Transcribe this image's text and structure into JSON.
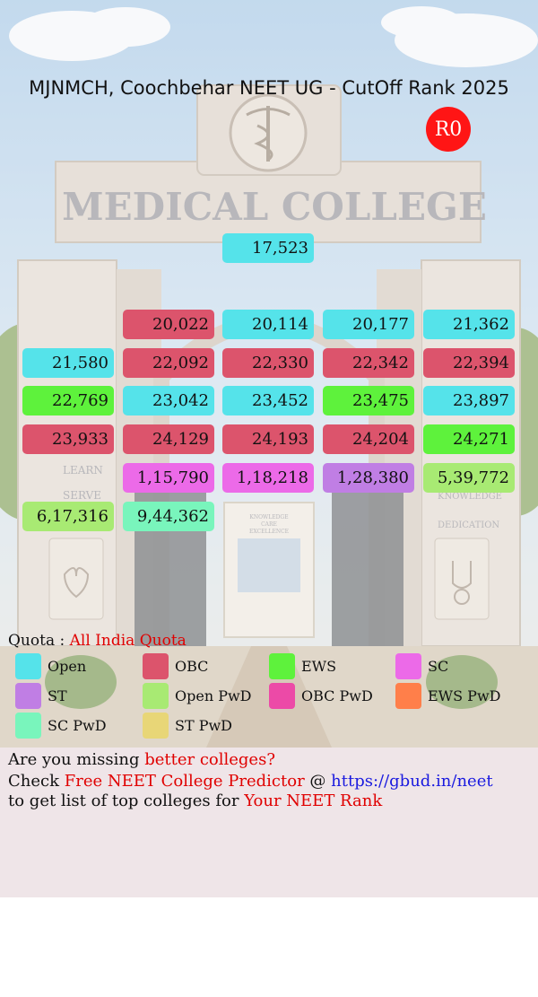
{
  "header": {
    "title": "MJNMCH, Coochbehar NEET UG - CutOff Rank 2025",
    "round_badge": "R0"
  },
  "background": {
    "gate_text": "MEDICAL COLLEGE",
    "left_pillar_words": [
      "LEARN",
      "SERVE"
    ],
    "right_pillar_words": [
      "KNOWLEDGE",
      "DEDICATION"
    ],
    "far_building_words": [
      "KNOWLEDGE",
      "CARE",
      "EXCELLENCE"
    ]
  },
  "colors": {
    "Open": "#55e3ea",
    "OBC": "#dc546c",
    "EWS": "#5ef23c",
    "SC": "#ec6ae8",
    "ST": "#c07ee4",
    "Open PwD": "#a8ea73",
    "OBC PwD": "#ec4aa7",
    "EWS PwD": "#ff7f4a",
    "SC PwD": "#79f5bc",
    "ST PwD": "#e8d677"
  },
  "ranks": [
    {
      "value": "17,523",
      "category": "Open"
    },
    {
      "value": "20,022",
      "category": "OBC"
    },
    {
      "value": "20,114",
      "category": "Open"
    },
    {
      "value": "20,177",
      "category": "Open"
    },
    {
      "value": "21,362",
      "category": "Open"
    },
    {
      "value": "21,580",
      "category": "Open"
    },
    {
      "value": "22,092",
      "category": "OBC"
    },
    {
      "value": "22,330",
      "category": "OBC"
    },
    {
      "value": "22,342",
      "category": "OBC"
    },
    {
      "value": "22,394",
      "category": "OBC"
    },
    {
      "value": "22,769",
      "category": "EWS"
    },
    {
      "value": "23,042",
      "category": "Open"
    },
    {
      "value": "23,452",
      "category": "Open"
    },
    {
      "value": "23,475",
      "category": "EWS"
    },
    {
      "value": "23,897",
      "category": "Open"
    },
    {
      "value": "23,933",
      "category": "OBC"
    },
    {
      "value": "24,129",
      "category": "OBC"
    },
    {
      "value": "24,193",
      "category": "OBC"
    },
    {
      "value": "24,204",
      "category": "OBC"
    },
    {
      "value": "24,271",
      "category": "EWS"
    },
    {
      "value": "1,15,790",
      "category": "SC"
    },
    {
      "value": "1,18,218",
      "category": "SC"
    },
    {
      "value": "1,28,380",
      "category": "ST"
    },
    {
      "value": "5,39,772",
      "category": "Open PwD"
    },
    {
      "value": "6,17,316",
      "category": "Open PwD"
    },
    {
      "value": "9,44,362",
      "category": "SC PwD"
    }
  ],
  "quota": {
    "label": "Quota :",
    "value": "All India Quota"
  },
  "legend": [
    {
      "label": "Open",
      "category": "Open"
    },
    {
      "label": "OBC",
      "category": "OBC"
    },
    {
      "label": "EWS",
      "category": "EWS"
    },
    {
      "label": "SC",
      "category": "SC"
    },
    {
      "label": "ST",
      "category": "ST"
    },
    {
      "label": "Open PwD",
      "category": "Open PwD"
    },
    {
      "label": "OBC PwD",
      "category": "OBC PwD"
    },
    {
      "label": "EWS PwD",
      "category": "EWS PwD"
    },
    {
      "label": "SC PwD",
      "category": "SC PwD"
    },
    {
      "label": "ST PwD",
      "category": "ST PwD"
    }
  ],
  "promo": {
    "line1_prefix": "Are you missing ",
    "line1_highlight": "better colleges?",
    "line2_prefix": "Check ",
    "line2_highlight": "Free NEET College Predictor",
    "line2_at": " @ ",
    "line2_link": "https://gbud.in/neet",
    "line3_prefix": "to get list of top colleges for ",
    "line3_highlight": "Your NEET Rank"
  }
}
